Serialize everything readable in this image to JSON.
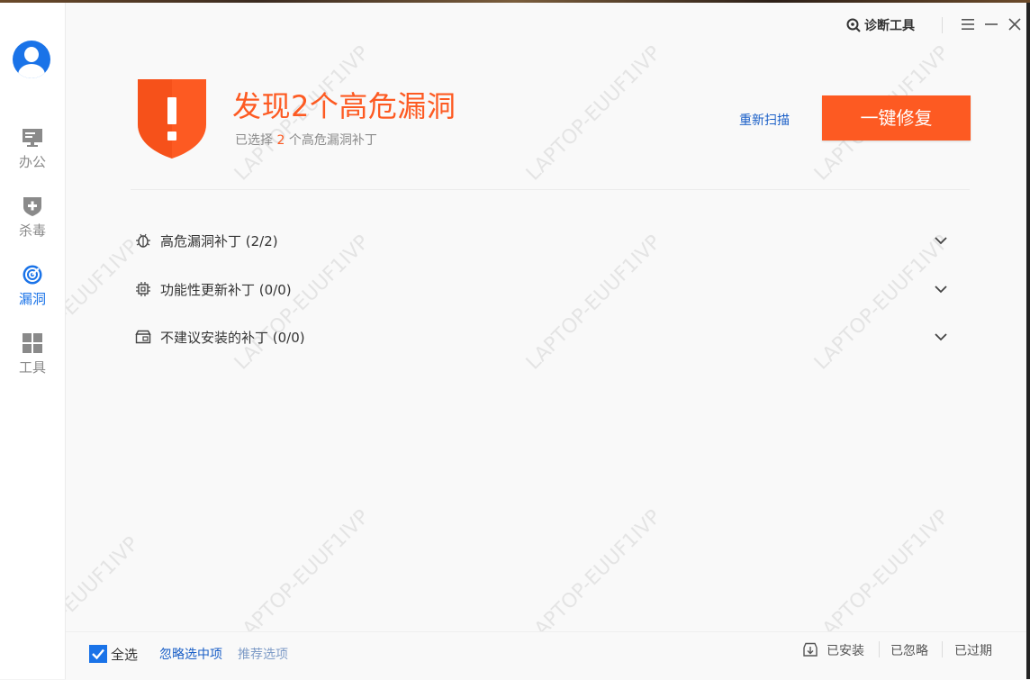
{
  "header": {
    "diagnostic_tool": "诊断工具",
    "menu_icon": "menu-icon",
    "minimize_icon": "minimize-icon",
    "close_icon": "close-icon"
  },
  "sidebar": {
    "avatar_icon": "user-avatar-icon",
    "items": [
      {
        "label": "办公",
        "icon": "monitor-icon",
        "active": false
      },
      {
        "label": "杀毒",
        "icon": "shield-plus-icon",
        "active": false
      },
      {
        "label": "漏洞",
        "icon": "radar-icon",
        "active": true
      },
      {
        "label": "工具",
        "icon": "grid-icon",
        "active": false
      }
    ]
  },
  "main": {
    "headline": "发现2个高危漏洞",
    "sub_prefix": "已选择",
    "sub_count": "2",
    "sub_suffix": "个高危漏洞补丁",
    "rescan_label": "重新扫描",
    "fix_label": "一键修复",
    "groups": [
      {
        "label": "高危漏洞补丁 (2/2)",
        "icon": "bug-icon"
      },
      {
        "label": "功能性更新补丁 (0/0)",
        "icon": "chip-icon"
      },
      {
        "label": "不建议安装的补丁 (0/0)",
        "icon": "package-icon"
      }
    ]
  },
  "footer": {
    "select_all": "全选",
    "ignore_selected": "忽略选中项",
    "recommended": "推荐选项",
    "installed": "已安装",
    "ignored": "已忽略",
    "expired": "已过期"
  },
  "watermark_text": "LAPTOP-EUUF1IVP",
  "colors": {
    "accent": "#fd5a22",
    "primary": "#1a73e8",
    "link": "#1a5fc7"
  }
}
